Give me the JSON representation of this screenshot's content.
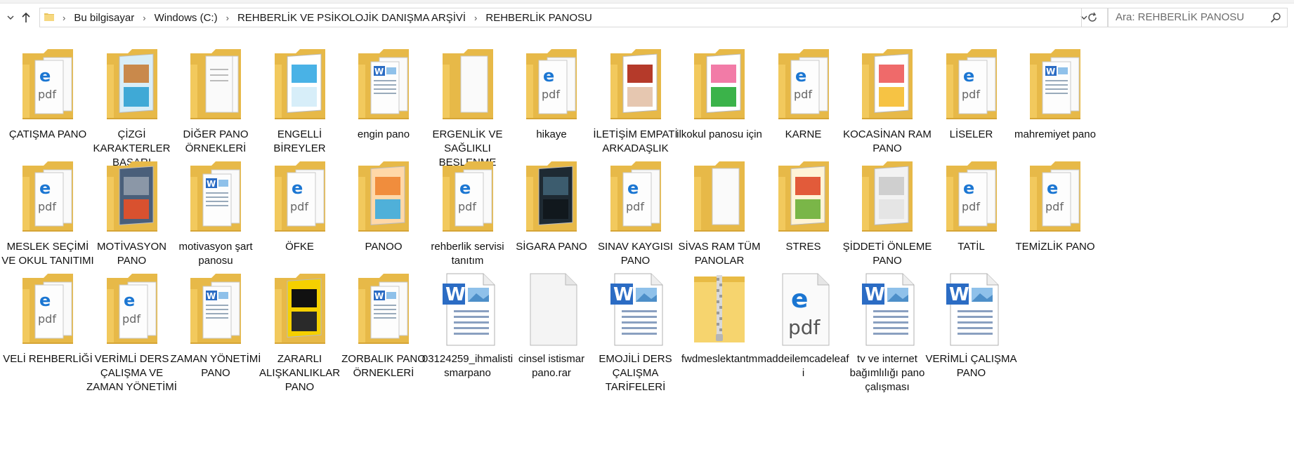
{
  "address_bar": {
    "crumbs": [
      "Bu bilgisayar",
      "Windows (C:)",
      "REHBERLİK VE PSİKOLOJİK DANIŞMA ARŞİVİ",
      "REHBERLİK PANOSU"
    ]
  },
  "search": {
    "placeholder": "Ara: REHBERLİK PANOSU"
  },
  "items": [
    {
      "name": "ÇATIŞMA PANO",
      "type": "folder-pdf"
    },
    {
      "name": "ÇİZGİ KARAKTERLER BAŞARI",
      "type": "folder-cartoon"
    },
    {
      "name": "DİĞER PANO ÖRNEKLERİ",
      "type": "folder-docs"
    },
    {
      "name": "ENGELLİ BİREYLER",
      "type": "folder-blue"
    },
    {
      "name": "engin pano",
      "type": "folder-word"
    },
    {
      "name": "ERGENLİK VE SAĞLIKLI BESLENME",
      "type": "folder-empty"
    },
    {
      "name": "hikaye",
      "type": "folder-pdf"
    },
    {
      "name": "İLETİŞİM EMPATİ ARKADAŞLIK",
      "type": "folder-photo"
    },
    {
      "name": "ilkokul panosu için",
      "type": "folder-clown"
    },
    {
      "name": "KARNE",
      "type": "folder-pdf"
    },
    {
      "name": "KOCASİNAN RAM PANO",
      "type": "folder-heart"
    },
    {
      "name": "LİSELER",
      "type": "folder-pdf"
    },
    {
      "name": "mahremiyet pano",
      "type": "folder-word"
    },
    {
      "name": "MESLEK SEÇİMİ VE OKUL TANITIMI",
      "type": "folder-pdf"
    },
    {
      "name": "MOTİVASYON PANO",
      "type": "folder-photo2"
    },
    {
      "name": "motivasyon şart panosu",
      "type": "folder-word"
    },
    {
      "name": "ÖFKE",
      "type": "folder-pdf"
    },
    {
      "name": "PANOO",
      "type": "folder-poster"
    },
    {
      "name": "rehberlik servisi tanıtım",
      "type": "folder-pdf"
    },
    {
      "name": "SİGARA PANO",
      "type": "folder-dark"
    },
    {
      "name": "SINAV KAYGISI PANO",
      "type": "folder-pdf"
    },
    {
      "name": "SİVAS RAM TÜM PANOLAR",
      "type": "folder-empty"
    },
    {
      "name": "STRES",
      "type": "folder-cartoon2"
    },
    {
      "name": "ŞİDDETİ ÖNLEME PANO",
      "type": "folder-paper"
    },
    {
      "name": "TATİL",
      "type": "folder-pdf"
    },
    {
      "name": "TEMİZLİK PANO",
      "type": "folder-pdf"
    },
    {
      "name": "VELİ REHBERLİĞİ",
      "type": "folder-pdf"
    },
    {
      "name": "VERİMLİ DERS ÇALIŞMA VE ZAMAN YÖNETİMİ",
      "type": "folder-pdf"
    },
    {
      "name": "ZAMAN YÖNETİMİ PANO",
      "type": "folder-word"
    },
    {
      "name": "ZARARLI ALIŞKANLIKLAR PANO",
      "type": "folder-book"
    },
    {
      "name": "ZORBALIK PANO ÖRNEKLERİ",
      "type": "folder-word"
    },
    {
      "name": "03124259_ihmalistismarpano",
      "type": "word"
    },
    {
      "name": "cinsel istismar pano.rar",
      "type": "blank"
    },
    {
      "name": "EMOJİLİ DERS ÇALIŞMA TARİFELERİ",
      "type": "word"
    },
    {
      "name": "fwdmeslektantm",
      "type": "zip"
    },
    {
      "name": "maddeilemcadeleafi",
      "type": "pdf"
    },
    {
      "name": "tv ve internet bağımlılığı pano çalışması",
      "type": "word"
    },
    {
      "name": "VERİMLİ ÇALIŞMA PANO",
      "type": "word"
    }
  ]
}
